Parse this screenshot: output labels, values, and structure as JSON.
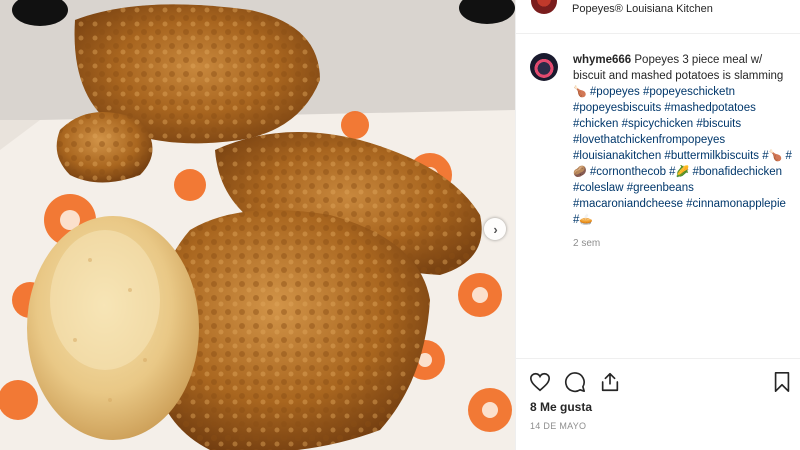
{
  "header": {
    "location": "Popeyes® Louisiana Kitchen"
  },
  "post": {
    "username": "whyme666",
    "caption_text": " Popeyes 3 piece meal w/ biscuit and mashed potatoes is slamming ",
    "caption_emoji": "🍗",
    "tags_line1": "#popeyes #popeyeschicketn #popeyesbiscuits #mashedpotatoes #chicken #spicychicken #biscuits #lovethatchickenfrompopeyes #louisianakitchen #buttermilkbiscuits",
    "tags_hash1": "#",
    "tags_emoji1": "🍗",
    "tags_hash2": " #",
    "tags_emoji2": "🥔",
    "tags_line2": " #cornonthecob #",
    "tags_emoji3": "🌽",
    "tags_line3": " #bonafidechicken #coleslaw #greenbeans #macaroniandcheese #cinnamonapplepie #",
    "tags_emoji4": "🥧",
    "time_ago": "2 sem"
  },
  "actions": {
    "likes": "8 Me gusta",
    "date": "14 DE MAYO"
  },
  "icons": {
    "like": "heart-icon",
    "comment": "comment-icon",
    "share": "share-icon",
    "save": "bookmark-icon",
    "next": "chevron-right-icon"
  },
  "colors": {
    "hashtag": "#00376b",
    "text": "#262626",
    "muted": "#8e8e8e",
    "popeyes_orange": "#f26b21"
  }
}
